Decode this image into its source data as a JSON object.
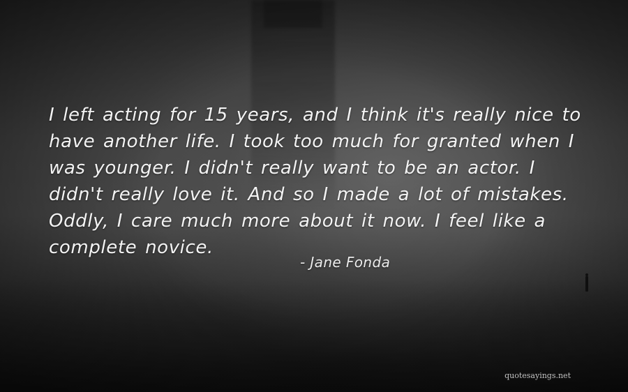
{
  "quote": {
    "lines": [
      "I left acting for 15 years, and I think it's really nice to",
      "have another life. I took too much for granted when I",
      "was younger. I didn't really want to be an actor. I",
      "didn't really love it. And so I made a lot of mistakes.",
      "Oddly, I care much more about it now. I feel like a",
      "complete novice."
    ],
    "author": "- Jane Fonda"
  },
  "watermark": "quotesayings.net",
  "colors": {
    "text": "#f3f3f3",
    "background": "#3a3a3a"
  }
}
